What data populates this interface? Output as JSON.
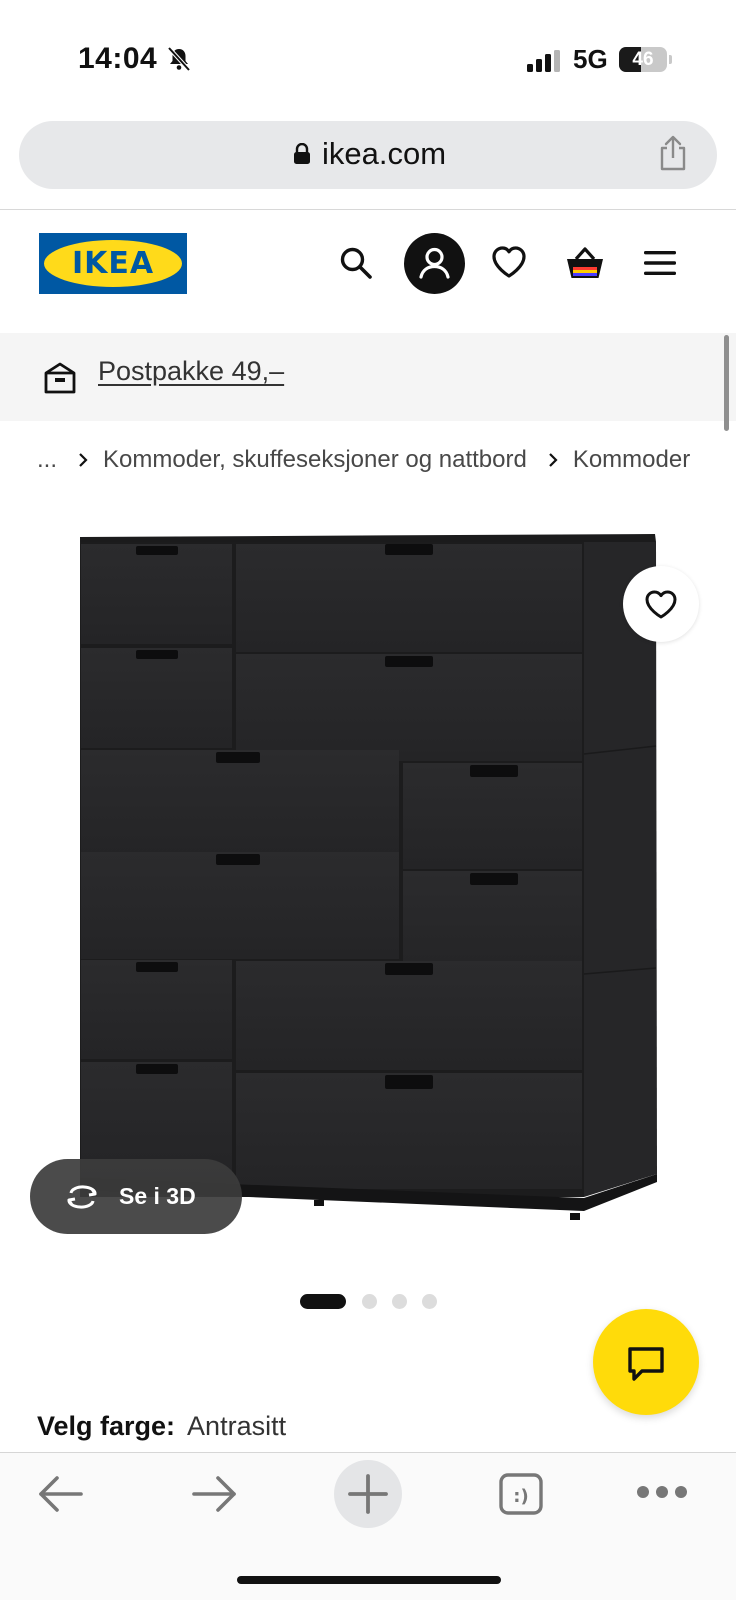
{
  "status_bar": {
    "time": "14:04",
    "network": "5G",
    "battery_level": "46",
    "battery_fraction": 0.46
  },
  "browser": {
    "url": "ikea.com",
    "icons": [
      "lock-icon",
      "share-icon"
    ]
  },
  "header": {
    "logo_text": "IKEA",
    "logo_colors": {
      "blue": "#0058a3",
      "yellow": "#ffda1a"
    },
    "icons": [
      "search-icon",
      "account-icon",
      "heart-icon",
      "shopping-bag-icon",
      "menu-icon"
    ]
  },
  "promo": {
    "icon": "parcel-icon",
    "text": "Postpakke 49,–"
  },
  "breadcrumb": {
    "items": [
      "...",
      "Kommoder, skuffeseksjoner og nattbord",
      "Kommoder"
    ]
  },
  "product": {
    "view_3d_label": "Se i 3D",
    "carousel": {
      "total": 4,
      "active": 1
    },
    "color_label": "Velg farge:",
    "color_value": "Antrasitt"
  },
  "chat": {
    "icon": "chat-icon",
    "accent": "#ffdb0a"
  },
  "toolbar": {
    "icons": [
      "back-arrow-icon",
      "forward-arrow-icon",
      "plus-icon",
      "tabs-icon",
      "more-icon"
    ],
    "tabs_glyph": ":)"
  }
}
